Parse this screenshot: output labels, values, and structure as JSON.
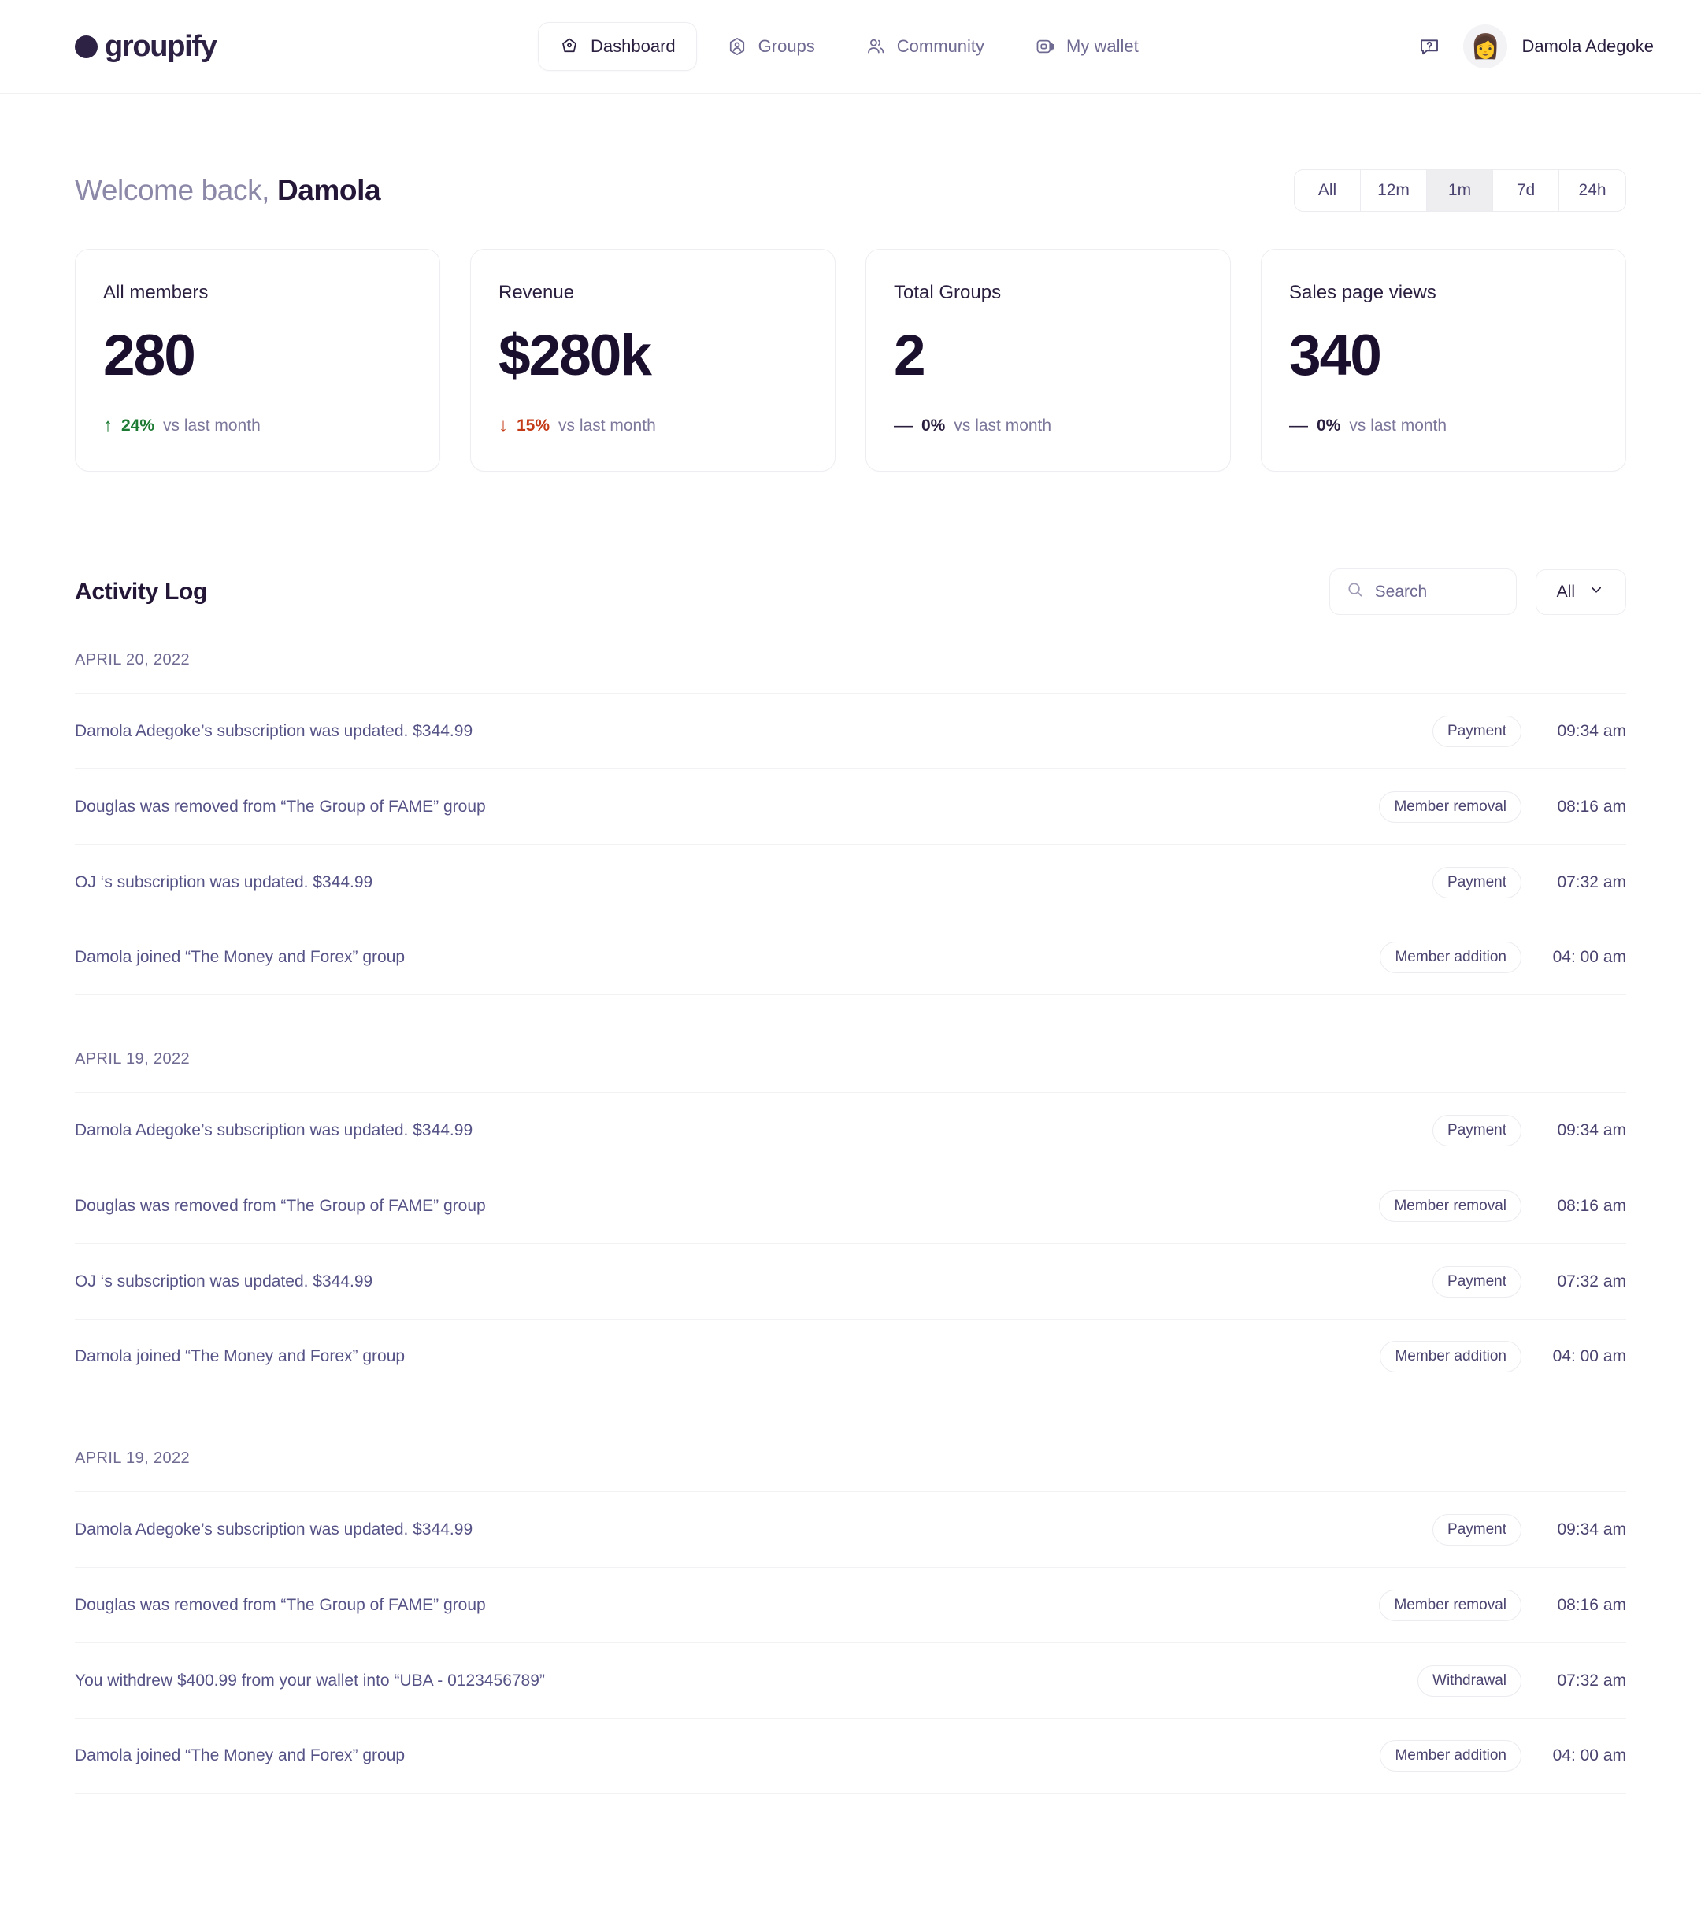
{
  "brand": {
    "name": "groupify",
    "logo_icon": "circle-dot-logo",
    "color": "#2e2244"
  },
  "nav": {
    "items": [
      {
        "label": "Dashboard",
        "icon": "home-pentagon-icon",
        "active": true
      },
      {
        "label": "Groups",
        "icon": "user-hexagon-icon",
        "active": false
      },
      {
        "label": "Community",
        "icon": "users-icon",
        "active": false
      },
      {
        "label": "My wallet",
        "icon": "wallet-icon",
        "active": false
      }
    ],
    "help_icon": "help-chat-icon",
    "user": {
      "name": "Damola Adegoke",
      "avatar_icon": "user-avatar",
      "avatar_emoji": "👩"
    }
  },
  "header": {
    "welcome_prefix": "Welcome back,",
    "welcome_name": "Damola",
    "ranges": [
      {
        "label": "All",
        "selected": false
      },
      {
        "label": "12m",
        "selected": false
      },
      {
        "label": "1m",
        "selected": true
      },
      {
        "label": "7d",
        "selected": false
      },
      {
        "label": "24h",
        "selected": false
      }
    ]
  },
  "stats": [
    {
      "title": "All members",
      "value": "280",
      "trend_icon": "↑",
      "trend_dir": "up",
      "change": "24%",
      "change_note": "vs last month"
    },
    {
      "title": "Revenue",
      "value": "$280k",
      "trend_icon": "↓",
      "trend_dir": "down",
      "change": "15%",
      "change_note": "vs last month"
    },
    {
      "title": "Total Groups",
      "value": "2",
      "trend_icon": "—",
      "trend_dir": "flat",
      "change": "0%",
      "change_note": "vs last month"
    },
    {
      "title": "Sales page views",
      "value": "340",
      "trend_icon": "—",
      "trend_dir": "flat",
      "change": "0%",
      "change_note": "vs last month"
    }
  ],
  "activity": {
    "title": "Activity Log",
    "search": {
      "placeholder": "Search",
      "value": "",
      "icon": "search-icon"
    },
    "filter": {
      "value": "All",
      "icon": "chevron-down-icon"
    },
    "groups": [
      {
        "date": "APRIL 20, 2022",
        "rows": [
          {
            "text": "Damola Adegoke’s subscription was updated. $344.99",
            "badge": "Payment",
            "time": "09:34 am"
          },
          {
            "text": "Douglas was removed from “The Group of FAME” group",
            "badge": "Member removal",
            "time": "08:16 am"
          },
          {
            "text": "OJ ‘s subscription was updated. $344.99",
            "badge": "Payment",
            "time": "07:32 am"
          },
          {
            "text": "Damola joined “The Money and Forex” group",
            "badge": "Member addition",
            "time": "04: 00 am"
          }
        ]
      },
      {
        "date": "APRIL 19, 2022",
        "rows": [
          {
            "text": "Damola Adegoke’s subscription was updated. $344.99",
            "badge": "Payment",
            "time": "09:34 am"
          },
          {
            "text": "Douglas was removed from “The Group of FAME” group",
            "badge": "Member removal",
            "time": "08:16 am"
          },
          {
            "text": "OJ ‘s subscription was updated. $344.99",
            "badge": "Payment",
            "time": "07:32 am"
          },
          {
            "text": "Damola joined “The Money and Forex” group",
            "badge": "Member addition",
            "time": "04: 00 am"
          }
        ]
      },
      {
        "date": "APRIL 19, 2022",
        "rows": [
          {
            "text": "Damola Adegoke’s subscription was updated. $344.99",
            "badge": "Payment",
            "time": "09:34 am"
          },
          {
            "text": "Douglas was removed from “The Group of FAME” group",
            "badge": "Member removal",
            "time": "08:16 am"
          },
          {
            "text": "You withdrew $400.99 from your wallet into “UBA - 0123456789”",
            "badge": "Withdrawal",
            "time": "07:32 am"
          },
          {
            "text": "Damola joined “The Money and Forex” group",
            "badge": "Member addition",
            "time": "04: 00 am"
          }
        ]
      }
    ]
  }
}
